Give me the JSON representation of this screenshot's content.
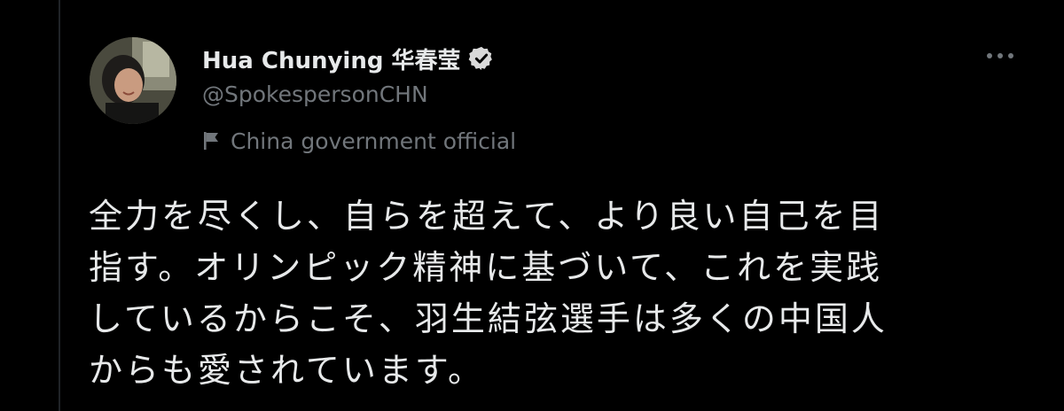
{
  "author": {
    "display_name": "Hua Chunying 华春莹",
    "handle": "@SpokespersonCHN",
    "label": "China government official",
    "verified": true
  },
  "tweet": {
    "lines": [
      "全力を尽くし、自らを超えて、より良い自己を目",
      "指す。オリンピック精神に基づいて、これを実践",
      "しているからこそ、羽生結弦選手は多くの中国人",
      "からも愛されています。"
    ]
  },
  "icons": {
    "verified": "verified-badge-icon",
    "label": "flag-icon",
    "more": "more-horizontal-icon"
  },
  "colors": {
    "background": "#000000",
    "text": "#e7e9ea",
    "secondary": "#71767b",
    "divider": "#202327"
  }
}
